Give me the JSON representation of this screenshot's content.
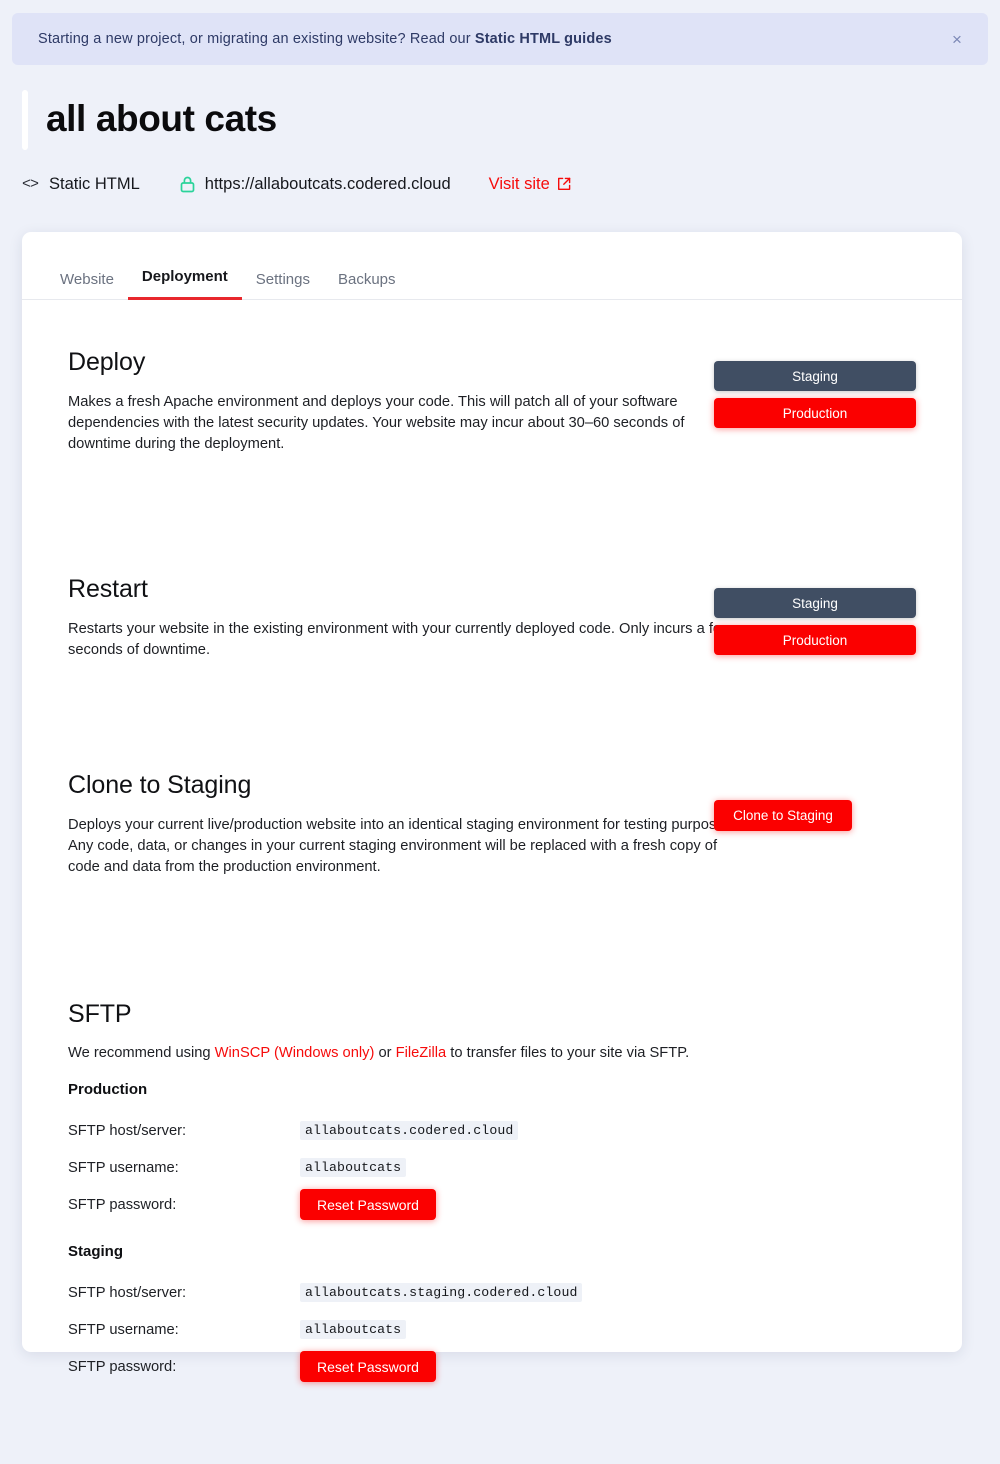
{
  "banner": {
    "text_before": "Starting a new project, or migrating an existing website? Read our ",
    "link_label": "Static HTML guides",
    "close_label": "×"
  },
  "header": {
    "site_title": "all about cats",
    "tech_label": "Static HTML",
    "code_icon": "<>",
    "url": "https://allaboutcats.codered.cloud",
    "visit_label": "Visit site"
  },
  "tabs": [
    {
      "label": "Website",
      "active": false
    },
    {
      "label": "Deployment",
      "active": true
    },
    {
      "label": "Settings",
      "active": false
    },
    {
      "label": "Backups",
      "active": false
    }
  ],
  "sections": {
    "deploy": {
      "title": "Deploy",
      "description": "Makes a fresh Apache environment and deploys your code. This will patch all of your software dependencies with the latest security updates. Your website may incur about 30–60 seconds of downtime during the deployment.",
      "staging_label": "Staging",
      "production_label": "Production"
    },
    "restart": {
      "title": "Restart",
      "description": "Restarts your website in the existing environment with your currently deployed code. Only incurs a few seconds of downtime.",
      "staging_label": "Staging",
      "production_label": "Production"
    },
    "clone": {
      "title": "Clone to Staging",
      "description": "Deploys your current live/production website into an identical staging environment for testing purposes. Any code, data, or changes in your current staging environment will be replaced with a fresh copy of code and data from the production environment.",
      "button_label": "Clone to Staging"
    },
    "sftp": {
      "title": "SFTP",
      "intro_before": "We recommend using ",
      "link_winscp": "WinSCP (Windows only)",
      "intro_middle": " or ",
      "link_filezilla": "FileZilla",
      "intro_after": " to transfer files to your site via SFTP.",
      "production": {
        "env_label": "Production",
        "host_label": "SFTP host/server:",
        "host_value": "allaboutcats.codered.cloud",
        "username_label": "SFTP username:",
        "username_value": "allaboutcats",
        "password_label": "SFTP password:",
        "reset_label": "Reset Password"
      },
      "staging": {
        "env_label": "Staging",
        "host_label": "SFTP host/server:",
        "host_value": "allaboutcats.staging.codered.cloud",
        "username_label": "SFTP username:",
        "username_value": "allaboutcats",
        "password_label": "SFTP password:",
        "reset_label": "Reset Password"
      }
    }
  },
  "colors": {
    "page_bg": "#eef1f9",
    "banner_bg": "#dfe3f7",
    "banner_text": "#2e3a66",
    "accent_red": "#fb0000",
    "link_red": "#f60b0b",
    "tab_active_underline": "#e8282d",
    "staging_btn": "#404e63",
    "lock_green": "#2ad39a",
    "card_bg": "#ffffff"
  }
}
